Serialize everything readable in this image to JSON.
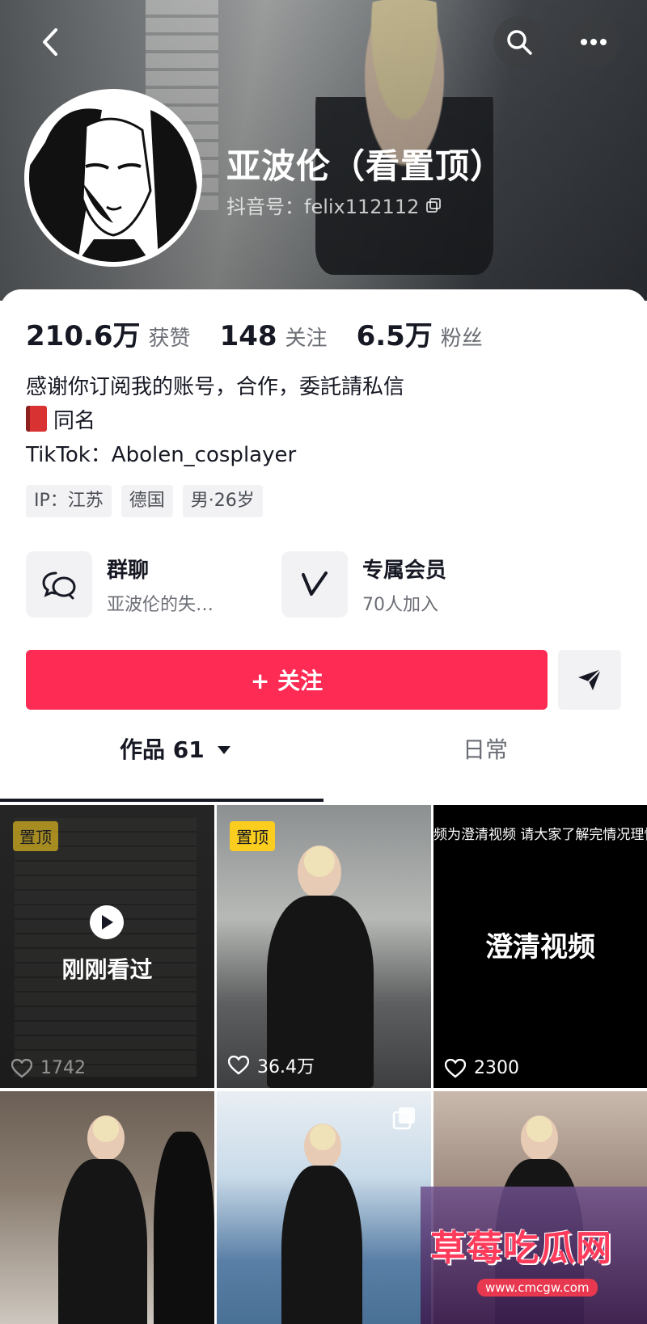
{
  "header": {
    "name": "亚波伦（看置顶）",
    "douyin_id": "抖音号：felix112112"
  },
  "stats": [
    {
      "value": "210.6万",
      "label": "获赞"
    },
    {
      "value": "148",
      "label": "关注"
    },
    {
      "value": "6.5万",
      "label": "粉丝"
    }
  ],
  "bio": {
    "line1": "感谢你订阅我的账号，合作，委託請私信",
    "line2": "同名",
    "line3": "TikTok：Abolen_cosplayer"
  },
  "tags": [
    "IP：江苏",
    "德国",
    "男·26岁"
  ],
  "features": {
    "group_chat": {
      "title": "群聊",
      "subtitle": "亚波伦的失…"
    },
    "membership": {
      "title": "专属会员",
      "subtitle": "70人加入"
    }
  },
  "actions": {
    "follow_label": "+ 关注"
  },
  "tabs": {
    "works": "作品 61",
    "daily": "日常"
  },
  "videos": [
    {
      "pinned": "置顶",
      "overlay": "刚刚看过",
      "likes": "1742"
    },
    {
      "pinned": "置顶",
      "likes": "36.4万"
    },
    {
      "top_text": "频为澄清视频 请大家了解完情况理性",
      "title": "澄清视频",
      "likes": "2300"
    }
  ],
  "watermark": {
    "title": "草莓吃瓜网",
    "url": "www.cmcgw.com"
  },
  "colors": {
    "accent": "#fe2c55",
    "pin": "#facd1e"
  }
}
